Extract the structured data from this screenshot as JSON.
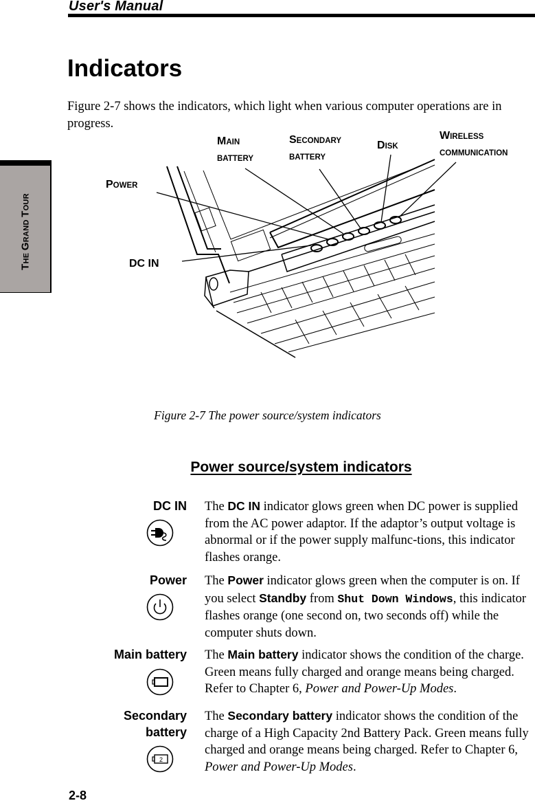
{
  "header": {
    "title": "User's Manual"
  },
  "side_tab": {
    "first": [
      "T",
      "HE "
    ],
    "second": [
      "G",
      "RAND "
    ],
    "third": [
      "T",
      "OUR"
    ]
  },
  "page_title": "Indicators",
  "intro": "Figure 2-7 shows the indicators, which light when various computer operations are in progress.",
  "figure": {
    "callouts": {
      "main_battery": {
        "cap": "M",
        "rest1": "AIN",
        "line2": "BATTERY"
      },
      "secondary_battery": {
        "cap": "S",
        "rest1": "ECONDARY",
        "line2": "BATTERY"
      },
      "disk": {
        "cap": "D",
        "rest1": "ISK"
      },
      "wireless": {
        "cap": "W",
        "rest1": "IRELESS",
        "line2": "COMMUNICATION"
      },
      "power": {
        "cap": "P",
        "rest1": "OWER"
      },
      "dc_in": {
        "label": "DC IN"
      }
    },
    "caption": "Figure 2-7 The power source/system indicators"
  },
  "section_title": "Power source/system indicators",
  "indicators": [
    {
      "label": "DC IN",
      "icon": "ac-plug-icon",
      "desc": [
        {
          "t": "The "
        },
        {
          "b": "DC IN"
        },
        {
          "t": " indicator glows green when DC power is supplied from the AC power adaptor. If the adaptor’s output voltage is abnormal or if the power supply malfunc-tions, this indicator flashes orange."
        }
      ]
    },
    {
      "label": "Power",
      "icon": "power-icon",
      "desc": [
        {
          "t": "The "
        },
        {
          "b": "Power"
        },
        {
          "t": " indicator glows green when the computer is on. If you select "
        },
        {
          "b": "Standby"
        },
        {
          "t": " from "
        },
        {
          "code": "Shut Down Windows"
        },
        {
          "t": ", this indicator flashes orange (one second on, two seconds off) while the computer shuts down."
        }
      ]
    },
    {
      "label": "Main battery",
      "icon": "battery-icon",
      "desc": [
        {
          "t": "The "
        },
        {
          "b": "Main battery"
        },
        {
          "t": " indicator shows the condition of the charge. Green means fully charged and orange means being charged. Refer to Chapter 6, "
        },
        {
          "i": "Power and Power-Up Modes"
        },
        {
          "t": "."
        }
      ]
    },
    {
      "label": "Secondary battery",
      "label_lines": [
        "Secondary",
        "battery"
      ],
      "icon": "secondary-battery-icon",
      "icon_text": "2",
      "desc": [
        {
          "t": "The "
        },
        {
          "b": "Secondary battery"
        },
        {
          "t": " indicator shows the condition of the charge of a High Capacity 2nd Battery Pack. Green means fully charged and orange means being charged. Refer to Chapter 6, "
        },
        {
          "i": "Power and Power-Up Modes"
        },
        {
          "t": "."
        }
      ]
    }
  ],
  "page_number": "2-8"
}
